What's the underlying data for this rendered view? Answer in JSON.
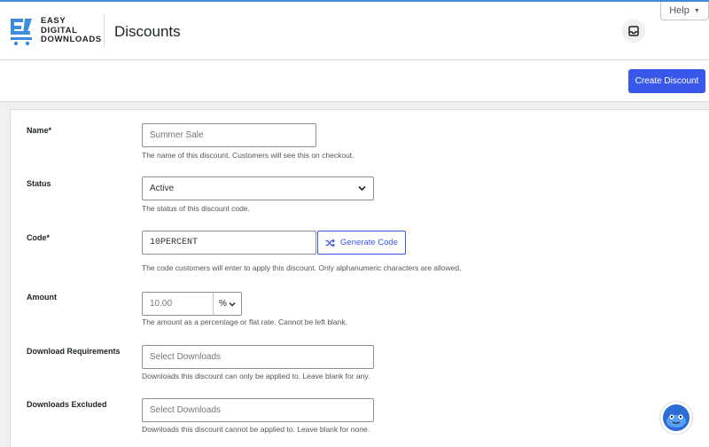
{
  "brand": {
    "logo_lines": [
      "EASY",
      "DIGITAL",
      "DOWNLOADS"
    ],
    "accent_color": "#3858e9",
    "logo_color": "#3c8dde"
  },
  "header": {
    "title": "Discounts",
    "help_label": "Help",
    "inbox_icon": "inbox-icon"
  },
  "actions": {
    "create_label": "Create Discount"
  },
  "form": {
    "name": {
      "label": "Name*",
      "placeholder": "Summer Sale",
      "description": "The name of this discount. Customers will see this on checkout."
    },
    "status": {
      "label": "Status",
      "selected": "Active",
      "description": "The status of this discount code."
    },
    "code": {
      "label": "Code*",
      "value": "10PERCENT",
      "generate_label": "Generate Code",
      "description": "The code customers will enter to apply this discount. Only alphanumeric characters are allowed."
    },
    "amount": {
      "label": "Amount",
      "placeholder": "10.00",
      "type": "%",
      "description": "The amount as a percentage or flat rate. Cannot be left blank."
    },
    "download_requirements": {
      "label": "Download Requirements",
      "placeholder": "Select Downloads",
      "description": "Downloads this discount can only be applied to. Leave blank for any."
    },
    "downloads_excluded": {
      "label": "Downloads Excluded",
      "placeholder": "Select Downloads",
      "description": "Downloads this discount cannot be applied to. Leave blank for none."
    }
  }
}
